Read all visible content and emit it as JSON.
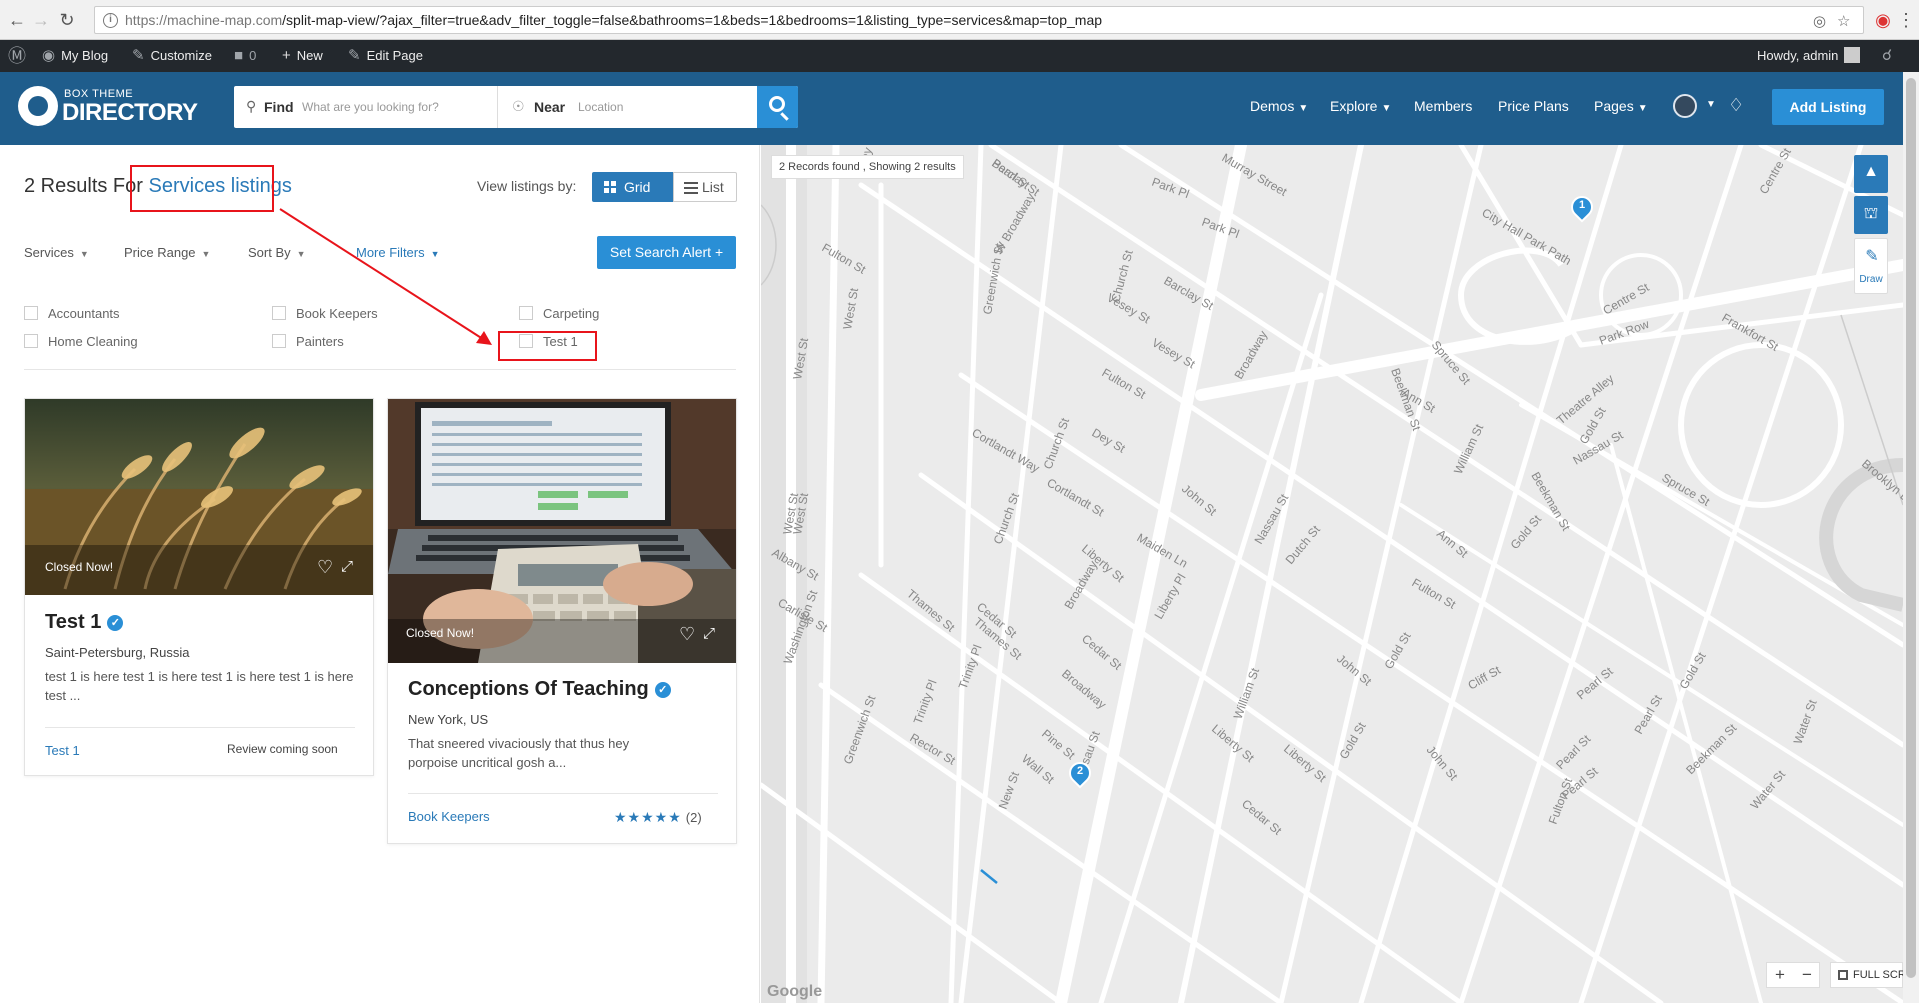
{
  "browser": {
    "url_host": "https://machine-map.com",
    "url_path": "/split-map-view/?ajax_filter=true&adv_filter_toggle=false&bathrooms=1&beds=1&bedrooms=1&listing_type=services&map=top_map"
  },
  "admin_bar": {
    "site_name": "My Blog",
    "customize": "Customize",
    "comments_count": "0",
    "new": "New",
    "edit_page": "Edit Page",
    "greeting": "Howdy, admin"
  },
  "header": {
    "logo_small": "BOX THEME",
    "logo_big": "DIRECTORY",
    "find_label": "Find",
    "find_placeholder": "What are you looking for?",
    "near_label": "Near",
    "near_placeholder": "Location",
    "nav": [
      {
        "label": "Demos",
        "caret": true
      },
      {
        "label": "Explore",
        "caret": true
      },
      {
        "label": "Members",
        "caret": false
      },
      {
        "label": "Price Plans",
        "caret": false
      },
      {
        "label": "Pages",
        "caret": true
      }
    ],
    "add_listing": "Add Listing"
  },
  "results": {
    "prefix": "2 Results For",
    "highlight": "Services listings",
    "view_label": "View listings by:",
    "grid": "Grid",
    "list": "List"
  },
  "filters": {
    "services": "Services",
    "price_range": "Price Range",
    "sort_by": "Sort By",
    "more_filters": "More Filters",
    "search_alert": "Set Search Alert"
  },
  "categories": [
    "Accountants",
    "Book Keepers",
    "Carpeting",
    "Home Cleaning",
    "Painters",
    "Test 1"
  ],
  "listings": [
    {
      "status": "Closed Now!",
      "title": "Test 1",
      "location": "Saint-Petersburg, Russia",
      "description": "test 1 is here test 1 is here test 1 is here test 1 is here test ...",
      "category": "Test 1",
      "review": "Review coming soon"
    },
    {
      "status": "Closed Now!",
      "title": "Conceptions Of Teaching",
      "location": "New York, US",
      "description": "That sneered vivaciously that thus hey porpoise uncritical gosh a...",
      "category": "Book Keepers",
      "stars": "★★★★★",
      "rating_count": "(2)",
      "rating": 5
    }
  ],
  "map": {
    "records": "2 Records found , Showing 2 results",
    "draw": "Draw",
    "fullscreen": "FULL SCREEN",
    "google": "Google",
    "pins": [
      "1",
      "2"
    ],
    "streets": [
      "Barclay St",
      "Murray Street",
      "Park Pl",
      "Park Pl",
      "Vesey St",
      "West St",
      "West St",
      "West St",
      "West St",
      "Fulton St",
      "W Broadway",
      "Greenwich St",
      "Church St",
      "Barclay St",
      "Vesey St",
      "Vesey St",
      "Centre St",
      "City Hall Park Path",
      "Centre St",
      "Frankfort St",
      "Park Row",
      "Broadway",
      "Spruce St",
      "Beekman St",
      "Fulton St",
      "Dey St",
      "Ann St",
      "Theatre Alley",
      "Nassau St",
      "Cortlandt Way",
      "Church St",
      "Cortlandt St",
      "John St",
      "William St",
      "Beekman St",
      "Gold St",
      "Spruce St",
      "Liberty St",
      "Church St",
      "Maiden Ln",
      "Dutch St",
      "Nassau St",
      "Ann St",
      "Fulton St",
      "Gold St",
      "Albany St",
      "Carlisle St",
      "Washington St",
      "Thames St",
      "Cedar St",
      "Thames St",
      "Trinity Pl",
      "Broadway",
      "Liberty Pl",
      "Cedar St",
      "Broadway",
      "Pine St",
      "John St",
      "Gold St",
      "Cliff St",
      "Pearl St",
      "Greenwich St",
      "Trinity Pl",
      "Rector St",
      "Liberty St",
      "William St",
      "Liberty St",
      "Gold St",
      "John St",
      "Pearl St",
      "Pearl St",
      "Fulton St",
      "Water St",
      "Water St",
      "New St",
      "Wall St",
      "Nassau St",
      "Cedar St",
      "Brooklyn Bridge",
      "Gold St",
      "Pearl St",
      "Beekman St",
      "Pearl St"
    ]
  },
  "colors": {
    "brand": "#1f5d8c",
    "accent": "#2a8fd6",
    "link": "#2a7ab8",
    "annotation": "#e8141b"
  }
}
